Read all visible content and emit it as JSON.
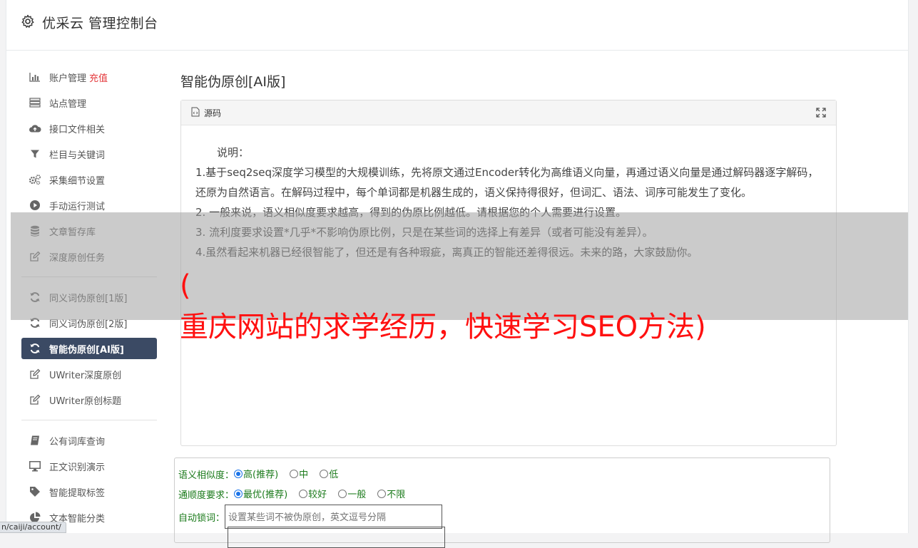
{
  "app": {
    "title": "优采云 管理控制台"
  },
  "sidebar": {
    "group1": [
      {
        "label": "账户管理",
        "extra": "充值",
        "icon": "bar-chart-icon"
      },
      {
        "label": "站点管理",
        "icon": "list-icon"
      },
      {
        "label": "接口文件相关",
        "icon": "cloud-upload-icon"
      },
      {
        "label": "栏目与关键词",
        "icon": "filter-icon"
      },
      {
        "label": "采集细节设置",
        "icon": "cogs-icon"
      },
      {
        "label": "手动运行测试",
        "icon": "play-circle-icon"
      },
      {
        "label": "文章暂存库",
        "icon": "database-icon"
      },
      {
        "label": "深度原创任务",
        "icon": "edit-icon"
      }
    ],
    "group2": [
      {
        "label": "同义词伪原创[1版]",
        "icon": "refresh-icon"
      },
      {
        "label": "同义词伪原创[2版]",
        "icon": "refresh-icon"
      },
      {
        "label": "智能伪原创[AI版]",
        "icon": "refresh-icon",
        "active": true
      },
      {
        "label": "UWriter深度原创",
        "icon": "edit-icon"
      },
      {
        "label": "UWriter原创标题",
        "icon": "edit-icon"
      }
    ],
    "group3": [
      {
        "label": "公有词库查询",
        "icon": "book-icon"
      },
      {
        "label": "正文识别演示",
        "icon": "desktop-icon"
      },
      {
        "label": "智能提取标签",
        "icon": "tag-icon"
      },
      {
        "label": "文本智能分类",
        "icon": "pie-chart-icon"
      }
    ]
  },
  "main": {
    "title": "智能伪原创[AI版]",
    "panel": {
      "head_label": "源码",
      "lines": [
        "　　说明：",
        "1.基于seq2seq深度学习模型的大规模训练，先将原文通过Encoder转化为高维语义向量，再通过语义向量是通过解码器逐字解码，还原为自然语言。在解码过程中，每个单词都是机器生成的，语义保持得很好，但词汇、语法、词序可能发生了变化。",
        "2. 一般来说，语义相似度要求越高，得到的伪原比例越低。请根据您的个人需要进行设置。",
        "3. 流利度要求设置*几乎*不影响伪原比例，只是在某些词的选择上有差异（或者可能没有差异）。",
        "4.虽然看起来机器已经很智能了，但还是有各种瑕疵，离真正的智能还差得很远。未来的路，大家鼓励你。"
      ]
    },
    "form": {
      "similarity": {
        "label": "语义相似度：",
        "options": [
          "高(推荐)",
          "中",
          "低"
        ],
        "selected": "高(推荐)"
      },
      "fluency": {
        "label": "通顺度要求：",
        "options": [
          "最优(推荐)",
          "较好",
          "一般",
          "不限"
        ],
        "selected": "最优(推荐)"
      },
      "lock": {
        "label": "自动锁词：",
        "placeholder": "设置某些词不被伪原创，英文逗号分隔"
      }
    }
  },
  "overlay": {
    "line1": "(",
    "line2": "重庆网站的求学经历，快速学习SEO方法)"
  },
  "statusbar": {
    "url": "n/caiji/account/"
  }
}
